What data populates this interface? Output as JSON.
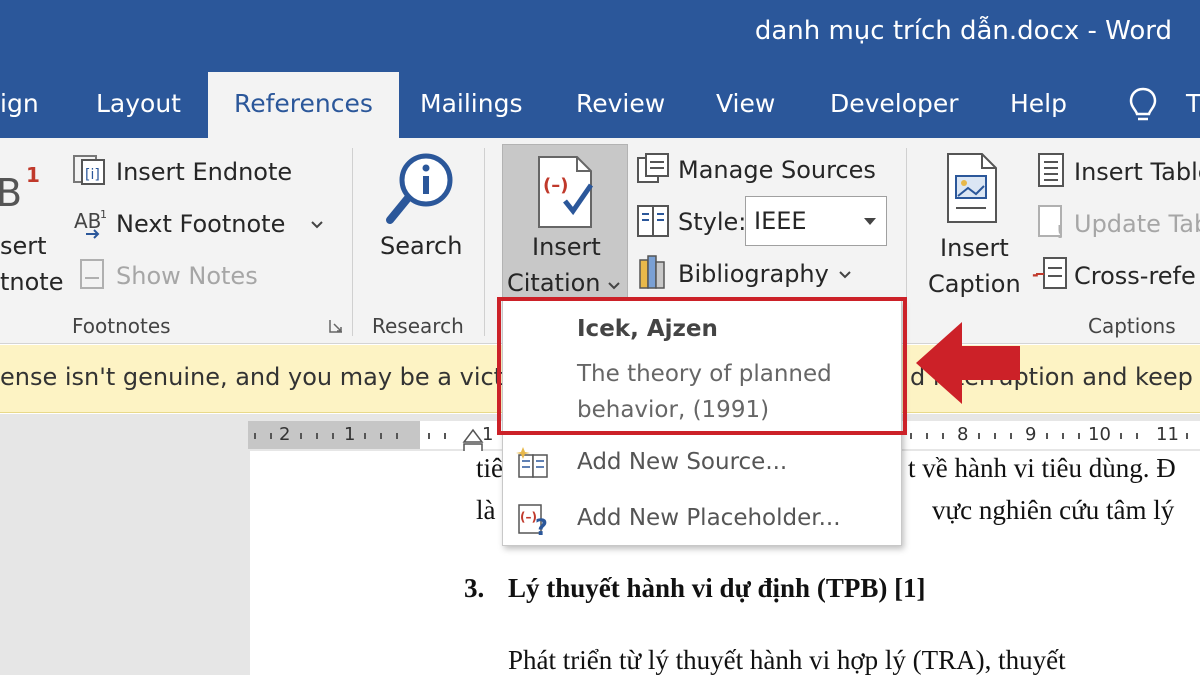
{
  "window": {
    "title": "danh mục trích dẫn.docx  -  Word"
  },
  "tabs": [
    {
      "label": "ign",
      "active": false
    },
    {
      "label": "Layout",
      "active": false
    },
    {
      "label": "References",
      "active": true
    },
    {
      "label": "Mailings",
      "active": false
    },
    {
      "label": "Review",
      "active": false
    },
    {
      "label": "View",
      "active": false
    },
    {
      "label": "Developer",
      "active": false
    },
    {
      "label": "Help",
      "active": false
    },
    {
      "label": "T",
      "active": false
    }
  ],
  "ribbon": {
    "footnotes": {
      "insert_footnote_line1": "sert",
      "insert_footnote_line2": "tnote",
      "insert_endnote": "Insert Endnote",
      "next_footnote": "Next Footnote",
      "show_notes": "Show Notes",
      "group_label": "Footnotes"
    },
    "research": {
      "search": "Search",
      "group_label": "Research"
    },
    "citations": {
      "insert_citation_line1": "Insert",
      "insert_citation_line2": "Citation",
      "manage_sources": "Manage Sources",
      "style_label": "Style:",
      "style_value": "IEEE",
      "bibliography": "Bibliography"
    },
    "captions": {
      "insert_caption_line1": "Insert",
      "insert_caption_line2": "Caption",
      "insert_table": "Insert Table",
      "update_table": "Update Tab",
      "cross_reference": "Cross-refe",
      "group_label": "Captions"
    }
  },
  "warning": {
    "text_left": "ense isn't genuine, and you may be a victim",
    "text_right": "d interruption and keep yo"
  },
  "ruler": {
    "numbers": [
      "2",
      "1",
      "1",
      "8",
      "9",
      "10",
      "11"
    ]
  },
  "document": {
    "line1_left": "tiê",
    "line1_right": "t về hành vi tiêu dùng. Đ",
    "line2_left": "là",
    "line2_right": "vực nghiên cứu tâm lý",
    "heading_number": "3.",
    "heading": "Lý thuyết hành vi dự định (TPB) [1]",
    "paragraph": "Phát triển từ lý thuyết hành vi hợp lý (TRA), thuyết"
  },
  "citation_menu": {
    "source_author": "Icek, Ajzen",
    "source_title": "The theory of planned behavior, (1991)",
    "add_new_source": "Add New Source...",
    "add_new_placeholder": "Add New Placeholder..."
  },
  "colors": {
    "brand": "#2b579a",
    "highlight": "#cc2128",
    "warning_bg": "#fdf3c4"
  }
}
